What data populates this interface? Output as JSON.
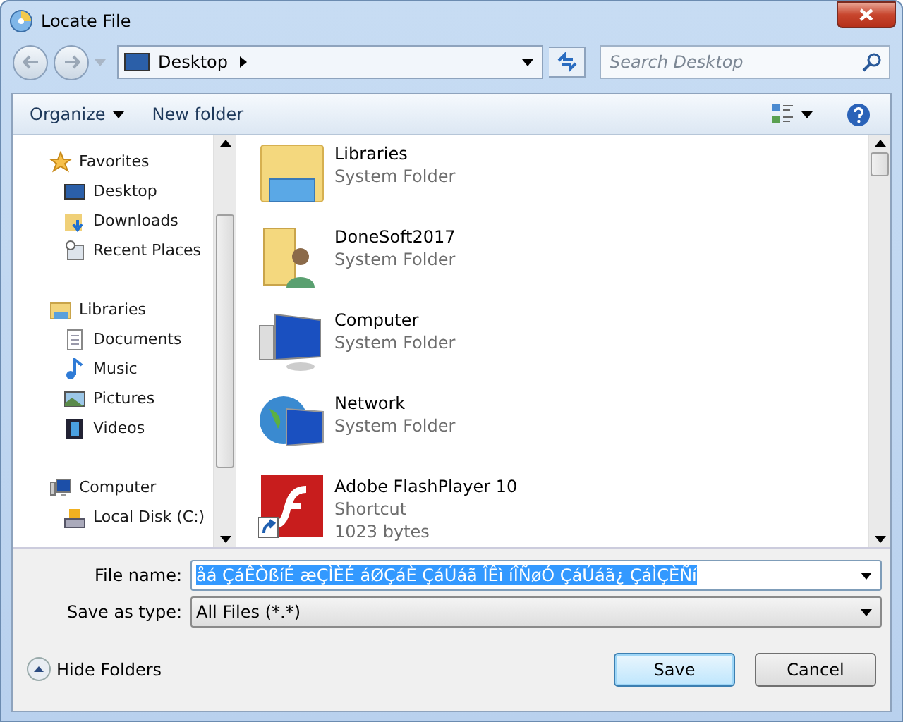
{
  "window": {
    "title": "Locate File"
  },
  "address": {
    "location": "Desktop"
  },
  "search": {
    "placeholder": "Search Desktop"
  },
  "toolbar": {
    "organize": "Organize",
    "new_folder": "New folder"
  },
  "sidebar": {
    "groups": [
      {
        "label": "Favorites",
        "kind": "favorites",
        "children": [
          {
            "label": "Desktop",
            "kind": "desktop"
          },
          {
            "label": "Downloads",
            "kind": "downloads"
          },
          {
            "label": "Recent Places",
            "kind": "recent"
          }
        ]
      },
      {
        "label": "Libraries",
        "kind": "libraries",
        "children": [
          {
            "label": "Documents",
            "kind": "documents"
          },
          {
            "label": "Music",
            "kind": "music"
          },
          {
            "label": "Pictures",
            "kind": "pictures"
          },
          {
            "label": "Videos",
            "kind": "videos"
          }
        ]
      },
      {
        "label": "Computer",
        "kind": "computer",
        "children": [
          {
            "label": "Local Disk (C:)",
            "kind": "disk"
          }
        ]
      }
    ]
  },
  "files": [
    {
      "name": "Libraries",
      "details": [
        "System Folder"
      ],
      "kind": "libraries"
    },
    {
      "name": "DoneSoft2017",
      "details": [
        "System Folder"
      ],
      "kind": "user"
    },
    {
      "name": "Computer",
      "details": [
        "System Folder"
      ],
      "kind": "computer"
    },
    {
      "name": "Network",
      "details": [
        "System Folder"
      ],
      "kind": "network"
    },
    {
      "name": "Adobe FlashPlayer 10",
      "details": [
        "Shortcut",
        "1023 bytes"
      ],
      "kind": "flash"
    }
  ],
  "file_name": {
    "label": "File name:",
    "value": "åá ÇáÊÒßíÉ æÇÌÈÉ áØÇáÈ ÇáÚáã ÎÊì íÎÑøÓ ÇáÚáã¿ ÇáÌÇÈÑí",
    "selected": true
  },
  "save_as_type": {
    "label": "Save as type:",
    "value": "All Files (*.*)"
  },
  "hide_folders": "Hide Folders",
  "buttons": [
    {
      "label": "Save",
      "default": true
    },
    {
      "label": "Cancel",
      "default": false
    }
  ]
}
